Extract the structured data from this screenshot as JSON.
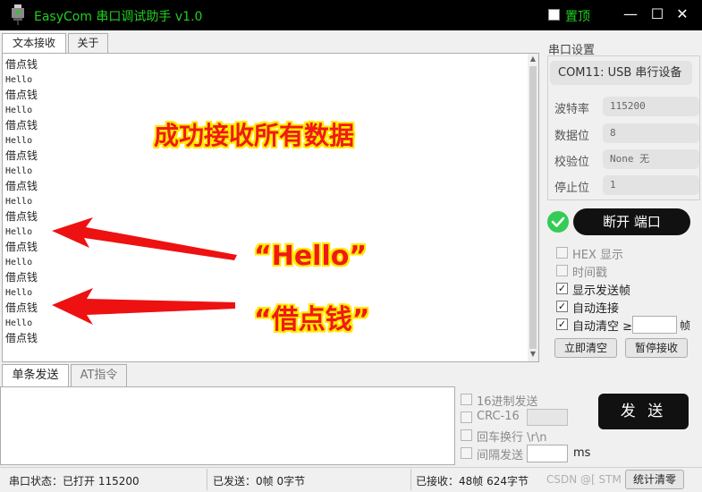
{
  "window": {
    "title": "EasyCom 串口调试助手 v1.0",
    "pin_label": "置顶",
    "minimize_icon": "—",
    "maximize_icon": "☐",
    "close_icon": "✕"
  },
  "tabs_top": [
    {
      "label": "文本接收",
      "active": true
    },
    {
      "label": "关于",
      "active": false
    }
  ],
  "receive": {
    "lines": [
      "借点钱",
      "Hello",
      "借点钱",
      "Hello",
      "借点钱",
      "Hello",
      "借点钱",
      "Hello",
      "借点钱",
      "Hello",
      "借点钱",
      "Hello",
      "借点钱",
      "Hello",
      "借点钱",
      "Hello",
      "借点钱",
      "Hello",
      "借点钱"
    ],
    "annotation_title": "成功接收所有数据",
    "annotation_hello": "“Hello”",
    "annotation_money": "“借点钱”"
  },
  "settings": {
    "group_label": "串口设置",
    "port": "COM11: USB 串行设备",
    "fields": [
      {
        "label": "波特率",
        "value": "115200"
      },
      {
        "label": "数据位",
        "value": "8"
      },
      {
        "label": "校验位",
        "value": "None  无"
      },
      {
        "label": "停止位",
        "value": "1"
      }
    ],
    "toggle_button": "断开 端口",
    "options": [
      {
        "label": "HEX 显示",
        "checked": false,
        "enabled": false
      },
      {
        "label": "时间戳",
        "checked": false,
        "enabled": false
      },
      {
        "label": "显示发送帧",
        "checked": true,
        "enabled": true
      },
      {
        "label": "自动连接",
        "checked": true,
        "enabled": true
      },
      {
        "label": "自动清空 ≥",
        "checked": true,
        "enabled": true
      }
    ],
    "frames_unit": "帧",
    "clear_button": "立即清空",
    "pause_button": "暂停接收"
  },
  "tabs_send": [
    {
      "label": "单条发送",
      "active": true
    },
    {
      "label": "AT指令",
      "active": false
    }
  ],
  "send": {
    "options": [
      {
        "label": "16进制发送",
        "checked": false
      },
      {
        "label": "CRC-16",
        "checked": false
      },
      {
        "label": "回车换行 \\r\\n",
        "checked": false
      },
      {
        "label": "间隔发送",
        "checked": false
      }
    ],
    "interval_unit": "ms",
    "send_button": "发 送"
  },
  "status": {
    "port_state": "串口状态：已打开 115200",
    "sent": "已发送：0帧  0字节",
    "received": "已接收：48帧  624字节",
    "watermark": "CSDN @[  STM",
    "reset_button": "统计清零"
  },
  "colors": {
    "title_green": "#1fd11f",
    "annotation_red": "#f01a14",
    "annotation_yellow": "#ffea00",
    "ok_green": "#33cc55"
  }
}
